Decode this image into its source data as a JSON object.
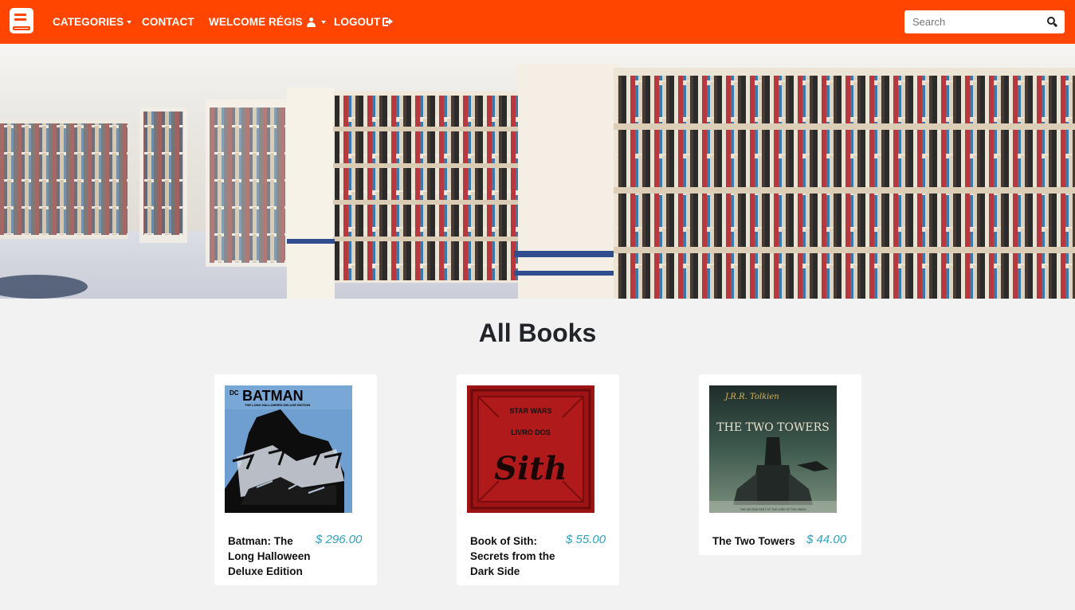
{
  "navbar": {
    "brand_icon": "book-icon",
    "categories_label": "CATEGORIES",
    "contact_label": "CONTACT",
    "welcome_label": "WELCOME RÉGIS",
    "logout_label": "LOGOUT",
    "search_placeholder": "Search",
    "accent_color": "#ff4500"
  },
  "hero": {
    "image": "library-bookshelves-photo"
  },
  "main": {
    "heading": "All Books",
    "books": [
      {
        "name": "Batman: The Long Halloween Deluxe Edition",
        "price": "$ 296.00",
        "cover_title": "BATMAN",
        "cover_subtitle": "THE LONG HALLOWEEN DELUXE EDITION",
        "cover_publisher": "DC"
      },
      {
        "name": "Book of Sith: Secrets from the Dark Side",
        "price": "$ 55.00",
        "cover_brand": "STAR WARS",
        "cover_title": "LIVRO DOS",
        "cover_word": "Sith"
      },
      {
        "name": "The Two Towers",
        "price": "$ 44.00",
        "cover_author": "J.R.R. Tolkien",
        "cover_title": "THE TWO TOWERS",
        "cover_footer": "THE SECOND PART OF THE LORD OF THE RINGS"
      }
    ],
    "price_color": "#2ea3bd"
  }
}
